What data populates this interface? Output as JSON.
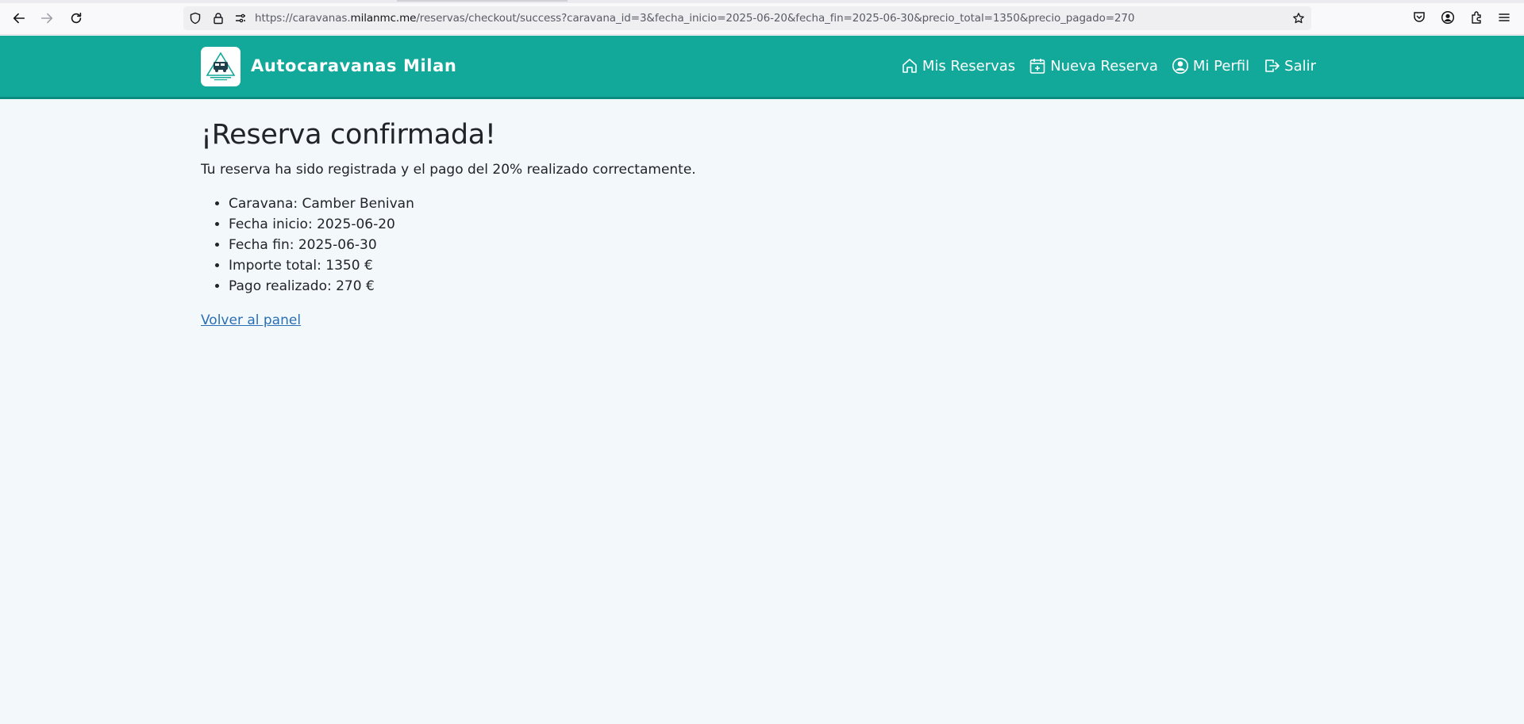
{
  "browser": {
    "url_prefix": "https://caravanas.",
    "url_host": "milanmc.me",
    "url_path": "/reservas/checkout/success?caravana_id=3&fecha_inicio=2025-06-20&fecha_fin=2025-06-30&precio_total=1350&precio_pagado=270"
  },
  "header": {
    "brand": "Autocaravanas Milan",
    "logo_caption": "Alquiler Caravanas Milan",
    "nav": [
      {
        "label": "Mis Reservas",
        "icon": "home-icon"
      },
      {
        "label": "Nueva Reserva",
        "icon": "calendar-plus-icon"
      },
      {
        "label": "Mi Perfil",
        "icon": "user-circle-icon"
      },
      {
        "label": "Salir",
        "icon": "logout-icon"
      }
    ]
  },
  "main": {
    "title": "¡Reserva confirmada!",
    "message": "Tu reserva ha sido registrada y el pago del 20% realizado correctamente.",
    "details": [
      "Caravana: Camber Benivan",
      "Fecha inicio: 2025-06-20",
      "Fecha fin: 2025-06-30",
      "Importe total: 1350 €",
      "Pago realizado: 270 €"
    ],
    "back_link": "Volver al panel"
  },
  "colors": {
    "header_bg": "#12a89a",
    "page_bg": "#f3f8fb",
    "link": "#2a6fb5"
  }
}
